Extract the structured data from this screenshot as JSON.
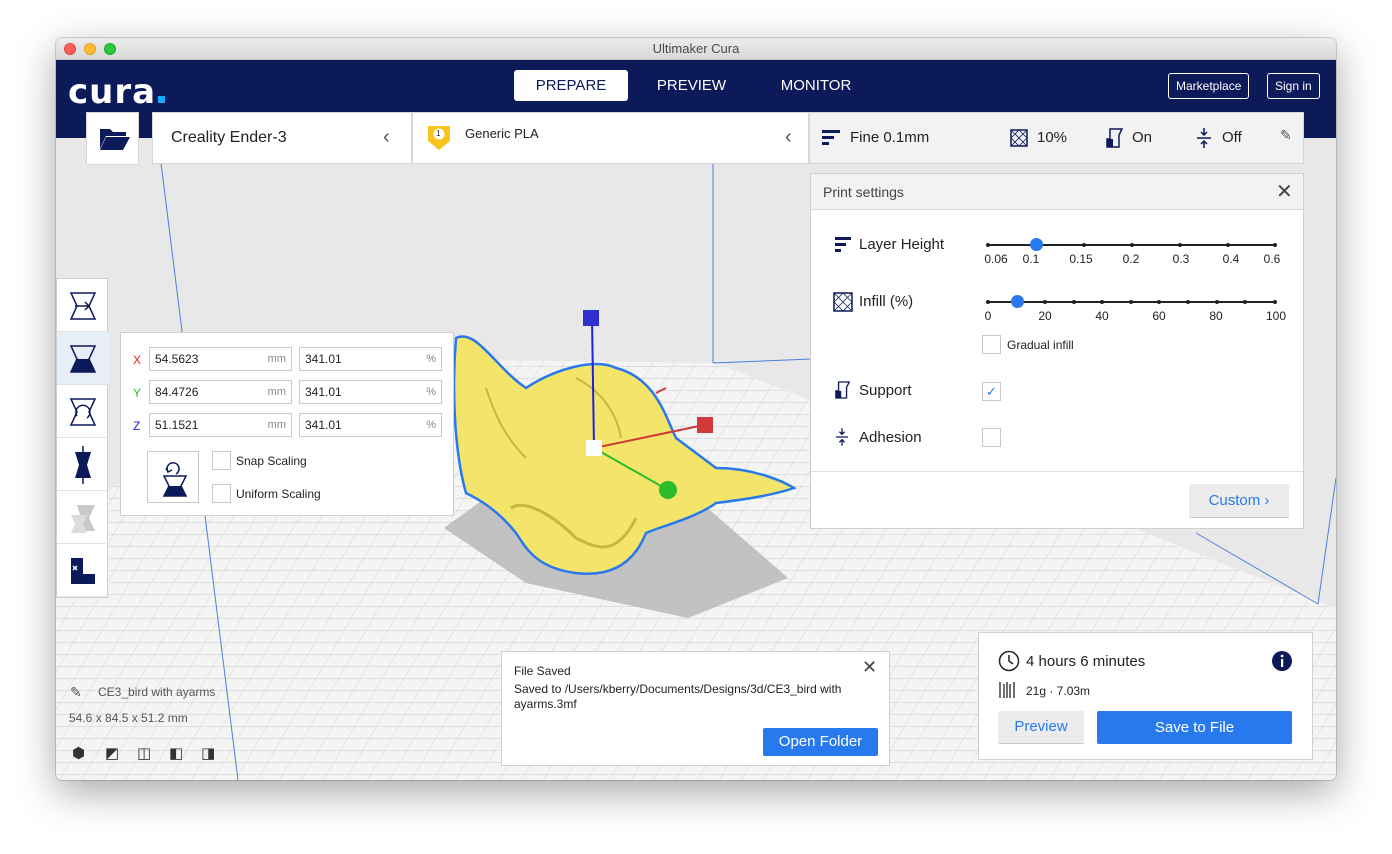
{
  "window": {
    "title": "Ultimaker Cura"
  },
  "header": {
    "logo": "cura",
    "tabs": [
      "PREPARE",
      "PREVIEW",
      "MONITOR"
    ],
    "marketplace_label": "Marketplace",
    "signin_label": "Sign in"
  },
  "printer": {
    "name": "Creality Ender-3"
  },
  "material": {
    "extruder_number": "1",
    "name": "Generic PLA"
  },
  "profile": {
    "quality": "Fine 0.1mm",
    "infill": "10%",
    "support": "On",
    "adhesion": "Off"
  },
  "print_settings": {
    "title": "Print settings",
    "layer_height_label": "Layer Height",
    "layer_height_ticks": [
      "0.06",
      "0.1",
      "0.15",
      "0.2",
      "0.3",
      "0.4",
      "0.6"
    ],
    "layer_height_value": "0.1",
    "infill_label": "Infill (%)",
    "infill_ticks": [
      "0",
      "20",
      "40",
      "60",
      "80",
      "100"
    ],
    "infill_value": 10,
    "gradual_infill_label": "Gradual infill",
    "gradual_infill_checked": false,
    "support_label": "Support",
    "support_checked": true,
    "adhesion_label": "Adhesion",
    "adhesion_checked": false,
    "custom_label": "Custom"
  },
  "scale_tool": {
    "x_label": "X",
    "y_label": "Y",
    "z_label": "Z",
    "x_mm": "54.5623",
    "y_mm": "84.4726",
    "z_mm": "51.1521",
    "x_pct": "341.01",
    "y_pct": "341.01",
    "z_pct": "341.01",
    "mm_unit": "mm",
    "pct_unit": "%",
    "snap_scaling_label": "Snap Scaling",
    "uniform_scaling_label": "Uniform Scaling",
    "x_color": "#e02020",
    "y_color": "#2bbb2b",
    "z_color": "#2020e0"
  },
  "object_info": {
    "name": "CE3_bird with ayarms",
    "dimensions": "54.6 x 84.5 x 51.2 mm"
  },
  "notification": {
    "title": "File Saved",
    "message": "Saved to /Users/kberry/Documents/Designs/3d/CE3_bird with ayarms.3mf",
    "button_label": "Open Folder"
  },
  "estimate": {
    "time": "4 hours 6 minutes",
    "material": "21g · 7.03m",
    "preview_label": "Preview",
    "save_label": "Save to File"
  },
  "colors": {
    "header_bg": "#0d1a5a",
    "accent": "#2879ee",
    "model": "#f4e56a",
    "model_outline": "#2879ee"
  }
}
